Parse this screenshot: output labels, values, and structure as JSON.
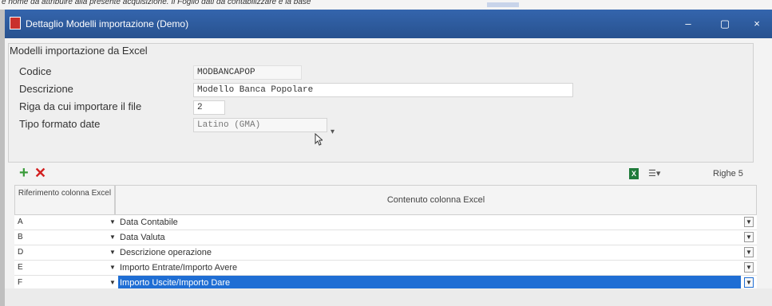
{
  "background_text": "e nome da attribuire alla presente acquisizione. Il Foglio dati da contabilizzare e la base",
  "window": {
    "title": "Dettaglio Modelli importazione (Demo)",
    "minimize": "–",
    "maximize": "▢",
    "close": "×"
  },
  "form": {
    "header": "Modelli importazione da Excel",
    "codice_label": "Codice",
    "codice_value": "MODBANCAPOP",
    "descrizione_label": "Descrizione",
    "descrizione_value": "Modello Banca Popolare",
    "riga_label": "Riga da cui importare il file",
    "riga_value": "2",
    "tipo_label": "Tipo formato date",
    "tipo_value": "Latino (GMA)"
  },
  "toolbar": {
    "add_icon": "+",
    "delete_icon": "✕",
    "excel_icon": "X",
    "menu_icon": "☰▾",
    "rows_label": "Righe 5"
  },
  "grid": {
    "col1_header": "Riferimento colonna Excel",
    "col2_header": "Contenuto colonna Excel",
    "rows": [
      {
        "ref": "A",
        "content": "Data Contabile"
      },
      {
        "ref": "B",
        "content": "Data Valuta"
      },
      {
        "ref": "D",
        "content": "Descrizione operazione"
      },
      {
        "ref": "E",
        "content": "Importo Entrate/Importo Avere"
      },
      {
        "ref": "F",
        "content": "Importo Uscite/Importo Dare"
      }
    ]
  },
  "colors": {
    "titlebar": "#2d5aa0",
    "selection": "#1f6ed4"
  }
}
